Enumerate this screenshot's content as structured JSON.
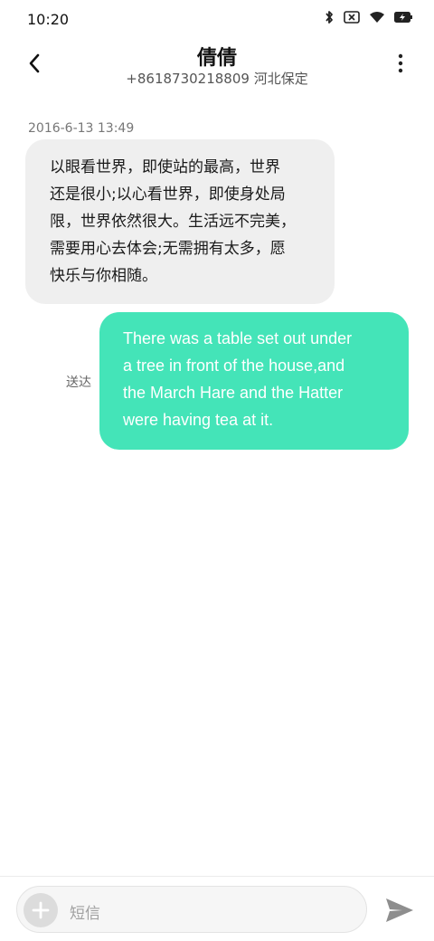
{
  "status_bar": {
    "time": "10:20",
    "icons": [
      "bluetooth-icon",
      "no-sim-icon",
      "wifi-icon",
      "battery-charging-icon"
    ]
  },
  "header": {
    "contact_name": "倩倩",
    "phone_location": "+8618730218809 河北保定",
    "back_icon": "chevron-left-icon",
    "more_icon": "more-vertical-icon"
  },
  "conversation": {
    "timestamp": "2016-6-13 13:49",
    "messages": [
      {
        "direction": "incoming",
        "lines": [
          "以眼看世界，即使站的最高，世界",
          "还是很小;以心看世界，即使身处局",
          "限，世界依然很大。生活远不完美，",
          "需要用心去体会;无需拥有太多，愿",
          "快乐与你相随。"
        ]
      },
      {
        "direction": "outgoing",
        "status": "送达",
        "lines": [
          "There was a table set out under",
          "a tree in front of the house,and",
          "the March Hare and the Hatter",
          "were having tea at it."
        ]
      }
    ]
  },
  "composer": {
    "placeholder": "短信",
    "add_icon": "plus-icon",
    "send_icon": "send-icon"
  },
  "colors": {
    "incoming_bubble": "#efefef",
    "outgoing_bubble": "#44e4b8",
    "outgoing_text": "#ffffff"
  }
}
